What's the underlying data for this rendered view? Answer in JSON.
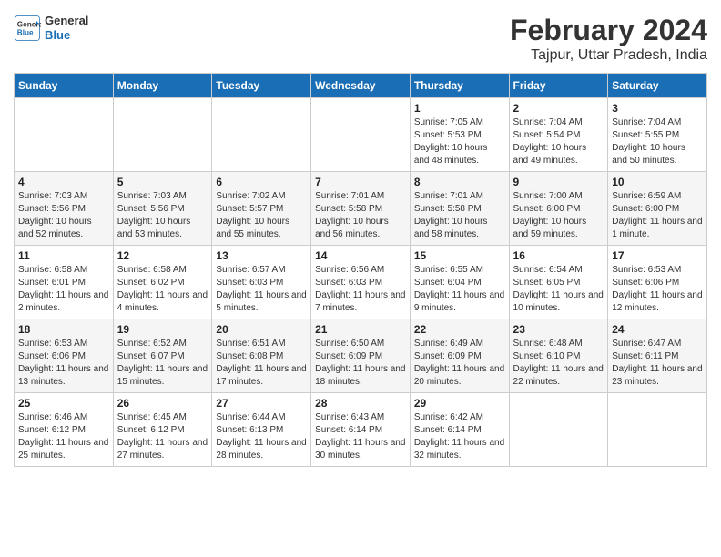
{
  "header": {
    "logo_line1": "General",
    "logo_line2": "Blue",
    "month_year": "February 2024",
    "location": "Tajpur, Uttar Pradesh, India"
  },
  "weekdays": [
    "Sunday",
    "Monday",
    "Tuesday",
    "Wednesday",
    "Thursday",
    "Friday",
    "Saturday"
  ],
  "weeks": [
    [
      {
        "day": "",
        "sunrise": "",
        "sunset": "",
        "daylight": ""
      },
      {
        "day": "",
        "sunrise": "",
        "sunset": "",
        "daylight": ""
      },
      {
        "day": "",
        "sunrise": "",
        "sunset": "",
        "daylight": ""
      },
      {
        "day": "",
        "sunrise": "",
        "sunset": "",
        "daylight": ""
      },
      {
        "day": "1",
        "sunrise": "Sunrise: 7:05 AM",
        "sunset": "Sunset: 5:53 PM",
        "daylight": "Daylight: 10 hours and 48 minutes."
      },
      {
        "day": "2",
        "sunrise": "Sunrise: 7:04 AM",
        "sunset": "Sunset: 5:54 PM",
        "daylight": "Daylight: 10 hours and 49 minutes."
      },
      {
        "day": "3",
        "sunrise": "Sunrise: 7:04 AM",
        "sunset": "Sunset: 5:55 PM",
        "daylight": "Daylight: 10 hours and 50 minutes."
      }
    ],
    [
      {
        "day": "4",
        "sunrise": "Sunrise: 7:03 AM",
        "sunset": "Sunset: 5:56 PM",
        "daylight": "Daylight: 10 hours and 52 minutes."
      },
      {
        "day": "5",
        "sunrise": "Sunrise: 7:03 AM",
        "sunset": "Sunset: 5:56 PM",
        "daylight": "Daylight: 10 hours and 53 minutes."
      },
      {
        "day": "6",
        "sunrise": "Sunrise: 7:02 AM",
        "sunset": "Sunset: 5:57 PM",
        "daylight": "Daylight: 10 hours and 55 minutes."
      },
      {
        "day": "7",
        "sunrise": "Sunrise: 7:01 AM",
        "sunset": "Sunset: 5:58 PM",
        "daylight": "Daylight: 10 hours and 56 minutes."
      },
      {
        "day": "8",
        "sunrise": "Sunrise: 7:01 AM",
        "sunset": "Sunset: 5:58 PM",
        "daylight": "Daylight: 10 hours and 58 minutes."
      },
      {
        "day": "9",
        "sunrise": "Sunrise: 7:00 AM",
        "sunset": "Sunset: 6:00 PM",
        "daylight": "Daylight: 10 hours and 59 minutes."
      },
      {
        "day": "10",
        "sunrise": "Sunrise: 6:59 AM",
        "sunset": "Sunset: 6:00 PM",
        "daylight": "Daylight: 11 hours and 1 minute."
      }
    ],
    [
      {
        "day": "11",
        "sunrise": "Sunrise: 6:58 AM",
        "sunset": "Sunset: 6:01 PM",
        "daylight": "Daylight: 11 hours and 2 minutes."
      },
      {
        "day": "12",
        "sunrise": "Sunrise: 6:58 AM",
        "sunset": "Sunset: 6:02 PM",
        "daylight": "Daylight: 11 hours and 4 minutes."
      },
      {
        "day": "13",
        "sunrise": "Sunrise: 6:57 AM",
        "sunset": "Sunset: 6:03 PM",
        "daylight": "Daylight: 11 hours and 5 minutes."
      },
      {
        "day": "14",
        "sunrise": "Sunrise: 6:56 AM",
        "sunset": "Sunset: 6:03 PM",
        "daylight": "Daylight: 11 hours and 7 minutes."
      },
      {
        "day": "15",
        "sunrise": "Sunrise: 6:55 AM",
        "sunset": "Sunset: 6:04 PM",
        "daylight": "Daylight: 11 hours and 9 minutes."
      },
      {
        "day": "16",
        "sunrise": "Sunrise: 6:54 AM",
        "sunset": "Sunset: 6:05 PM",
        "daylight": "Daylight: 11 hours and 10 minutes."
      },
      {
        "day": "17",
        "sunrise": "Sunrise: 6:53 AM",
        "sunset": "Sunset: 6:06 PM",
        "daylight": "Daylight: 11 hours and 12 minutes."
      }
    ],
    [
      {
        "day": "18",
        "sunrise": "Sunrise: 6:53 AM",
        "sunset": "Sunset: 6:06 PM",
        "daylight": "Daylight: 11 hours and 13 minutes."
      },
      {
        "day": "19",
        "sunrise": "Sunrise: 6:52 AM",
        "sunset": "Sunset: 6:07 PM",
        "daylight": "Daylight: 11 hours and 15 minutes."
      },
      {
        "day": "20",
        "sunrise": "Sunrise: 6:51 AM",
        "sunset": "Sunset: 6:08 PM",
        "daylight": "Daylight: 11 hours and 17 minutes."
      },
      {
        "day": "21",
        "sunrise": "Sunrise: 6:50 AM",
        "sunset": "Sunset: 6:09 PM",
        "daylight": "Daylight: 11 hours and 18 minutes."
      },
      {
        "day": "22",
        "sunrise": "Sunrise: 6:49 AM",
        "sunset": "Sunset: 6:09 PM",
        "daylight": "Daylight: 11 hours and 20 minutes."
      },
      {
        "day": "23",
        "sunrise": "Sunrise: 6:48 AM",
        "sunset": "Sunset: 6:10 PM",
        "daylight": "Daylight: 11 hours and 22 minutes."
      },
      {
        "day": "24",
        "sunrise": "Sunrise: 6:47 AM",
        "sunset": "Sunset: 6:11 PM",
        "daylight": "Daylight: 11 hours and 23 minutes."
      }
    ],
    [
      {
        "day": "25",
        "sunrise": "Sunrise: 6:46 AM",
        "sunset": "Sunset: 6:12 PM",
        "daylight": "Daylight: 11 hours and 25 minutes."
      },
      {
        "day": "26",
        "sunrise": "Sunrise: 6:45 AM",
        "sunset": "Sunset: 6:12 PM",
        "daylight": "Daylight: 11 hours and 27 minutes."
      },
      {
        "day": "27",
        "sunrise": "Sunrise: 6:44 AM",
        "sunset": "Sunset: 6:13 PM",
        "daylight": "Daylight: 11 hours and 28 minutes."
      },
      {
        "day": "28",
        "sunrise": "Sunrise: 6:43 AM",
        "sunset": "Sunset: 6:14 PM",
        "daylight": "Daylight: 11 hours and 30 minutes."
      },
      {
        "day": "29",
        "sunrise": "Sunrise: 6:42 AM",
        "sunset": "Sunset: 6:14 PM",
        "daylight": "Daylight: 11 hours and 32 minutes."
      },
      {
        "day": "",
        "sunrise": "",
        "sunset": "",
        "daylight": ""
      },
      {
        "day": "",
        "sunrise": "",
        "sunset": "",
        "daylight": ""
      }
    ]
  ]
}
